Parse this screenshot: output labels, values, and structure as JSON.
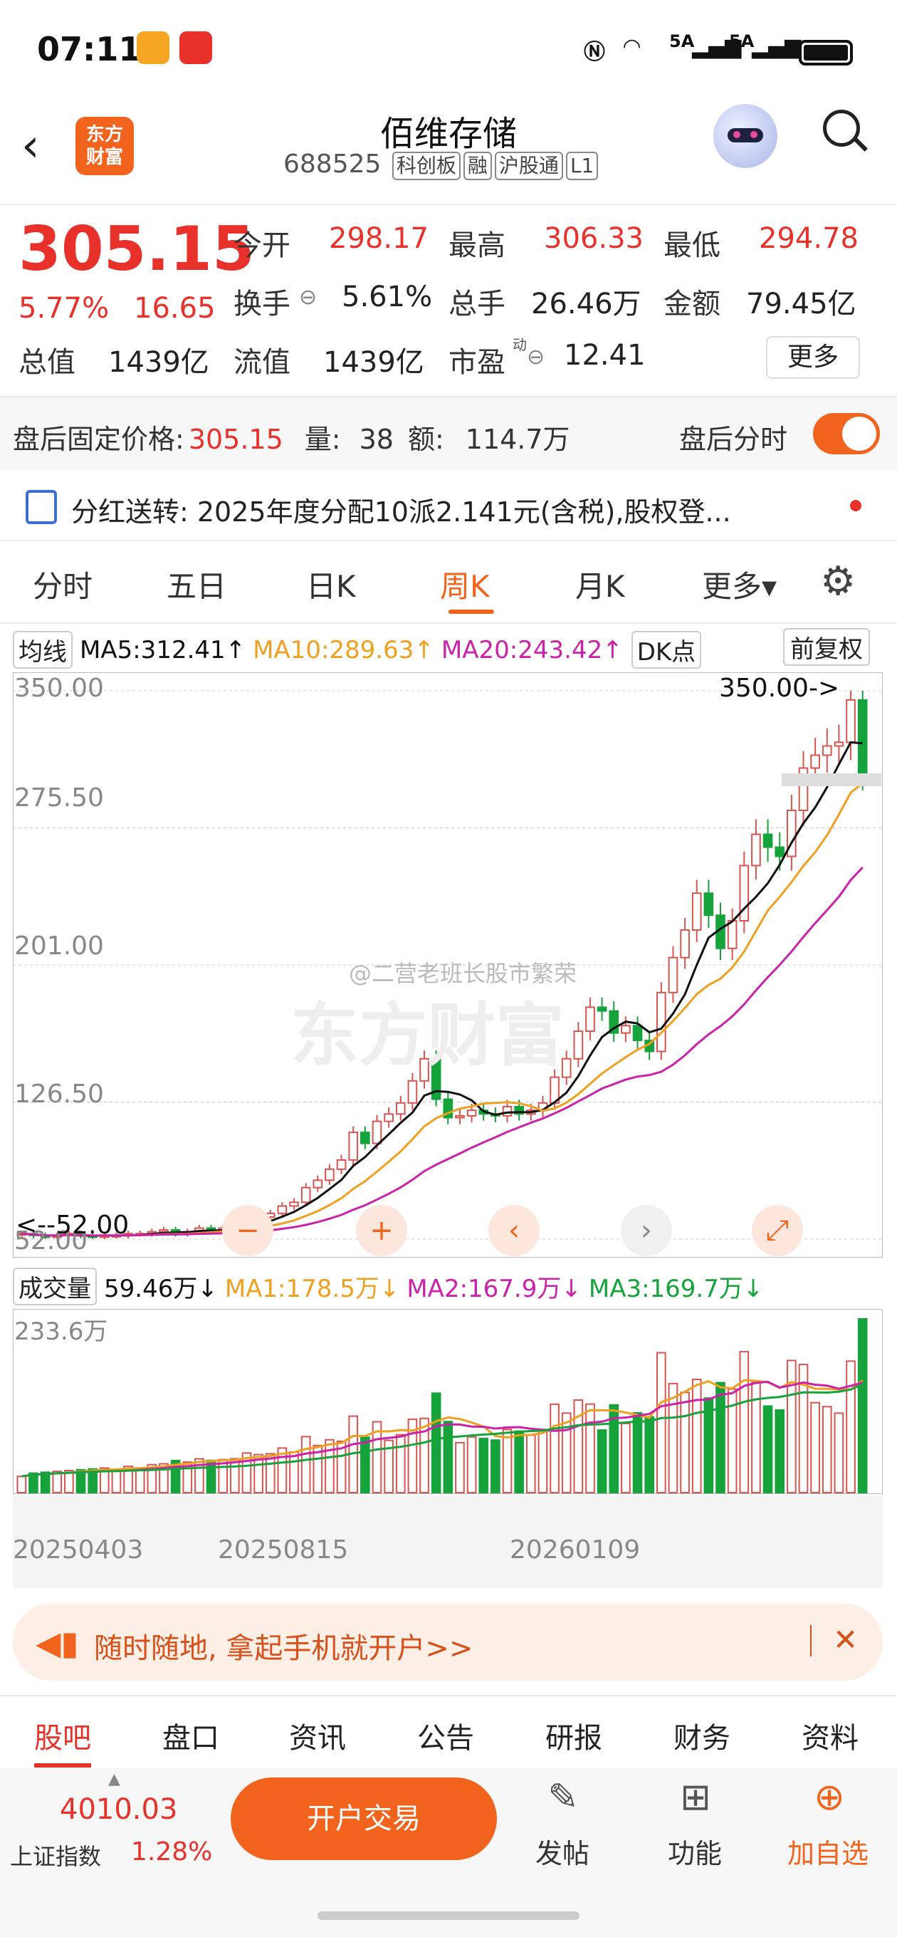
{
  "status": {
    "time": "07:11",
    "net1": "5A",
    "net2": "5A"
  },
  "header": {
    "logo_line1": "东方",
    "logo_line2": "财富",
    "title": "佰维存储",
    "code": "688525",
    "tags": [
      "科创板",
      "融",
      "沪股通",
      "L1"
    ]
  },
  "quote": {
    "price": "305.15",
    "change_pct": "5.77%",
    "change": "16.65",
    "open_label": "今开",
    "open": "298.17",
    "high_label": "最高",
    "high": "306.33",
    "low_label": "最低",
    "low": "294.78",
    "turnover_label": "换手",
    "turnover": "5.61%",
    "volume_label": "总手",
    "volume": "26.46万",
    "amount_label": "金额",
    "amount": "79.45亿",
    "mcap_label": "总值",
    "mcap": "1439亿",
    "float_label": "流值",
    "float": "1439亿",
    "pe_label": "市盈",
    "pe_sup": "动",
    "pe": "12.41",
    "more": "更多"
  },
  "after_hours": {
    "label": "盘后固定价格:",
    "price": "305.15",
    "vol_label": "量:",
    "vol": "38",
    "amt_label": "额:",
    "amt": "114.7万",
    "toggle_label": "盘后分时",
    "toggle_on": true
  },
  "notice": {
    "text": "分红送转: 2025年度分配10派2.141元(含税),股权登..."
  },
  "tabs": [
    "分时",
    "五日",
    "日K",
    "周K",
    "月K",
    "更多▾"
  ],
  "active_tab": "周K",
  "ma_bar": {
    "selector": "均线",
    "ma5": "MA5:312.41↑",
    "ma10": "MA10:289.63↑",
    "ma20": "MA20:243.42↑",
    "dk": "DK点",
    "adjust": "前复权"
  },
  "chart_labels": {
    "y1": "350.00",
    "y2": "275.50",
    "y3": "201.00",
    "y4": "126.50",
    "y5": "52.00",
    "max_marker": "350.00->",
    "min_marker": "<--52.00"
  },
  "watermark": {
    "weibo": "@二营老班长股市繁荣",
    "brand": "东方财富"
  },
  "vol_bar": {
    "selector": "成交量",
    "vol": "59.46万↓",
    "ma1": "MA1:178.5万↓",
    "ma2": "MA2:167.9万↓",
    "ma3": "MA3:169.7万↓",
    "max": "233.6万"
  },
  "x_dates": [
    "20250403",
    "20250815",
    "20260109"
  ],
  "colors": {
    "up": "#d9534f",
    "down": "#16a33b",
    "ma5": "#111111",
    "ma10": "#f0a020",
    "ma20": "#cc22aa",
    "accent": "#f2641e"
  },
  "chart_data": {
    "type": "candlestick",
    "closes_approx": [
      55,
      54,
      53,
      54,
      55,
      54,
      53,
      54,
      54,
      55,
      55,
      56,
      57,
      55,
      56,
      58,
      57,
      58,
      59,
      62,
      64,
      66,
      70,
      72,
      80,
      84,
      90,
      95,
      110,
      104,
      116,
      120,
      126,
      138,
      150,
      128,
      118,
      119,
      122,
      120,
      119,
      124,
      120,
      122,
      126,
      140,
      150,
      165,
      178,
      176,
      164,
      168,
      160,
      154,
      186,
      205,
      220,
      240,
      228,
      210,
      225,
      255,
      272,
      265,
      260,
      285,
      308,
      315,
      320,
      322,
      345,
      305
    ],
    "ma5_last": 312.41,
    "ma10_last": 289.63,
    "ma20_last": 243.42,
    "ylim": [
      52,
      350
    ],
    "vol_ma1": 178.5,
    "vol_ma2": 167.9,
    "vol_ma3": 169.7,
    "vol_max": 233.6
  },
  "banner": {
    "text": "随时随地, 拿起手机就开户>>"
  },
  "bottom_tabs": [
    "股吧",
    "盘口",
    "资讯",
    "公告",
    "研报",
    "财务",
    "资料"
  ],
  "footer": {
    "index_value": "4010.03",
    "index_name": "上证指数",
    "index_pct": "1.28%",
    "trade_button": "开户交易",
    "post": "发帖",
    "functions": "功能",
    "add_watch": "加自选"
  }
}
